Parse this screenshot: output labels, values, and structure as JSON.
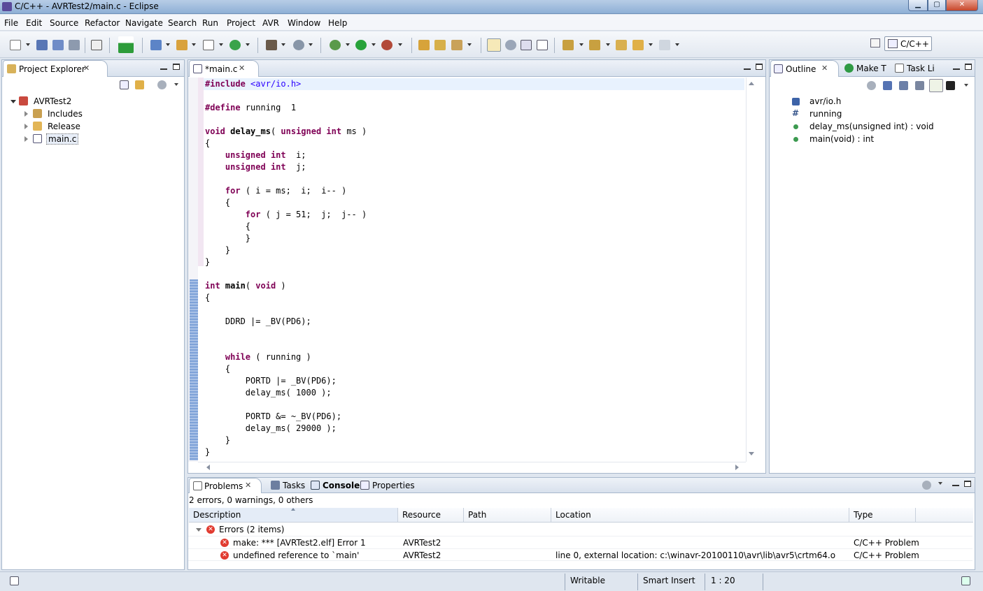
{
  "window": {
    "title": "C/C++ - AVRTest2/main.c - Eclipse",
    "min": "▁",
    "max": "▢",
    "close": "✕"
  },
  "menu": [
    "File",
    "Edit",
    "Source",
    "Refactor",
    "Navigate",
    "Search",
    "Run",
    "Project",
    "AVR",
    "Window",
    "Help"
  ],
  "toolbar": {
    "avr_label": "AVR",
    "perspective": "C/C++"
  },
  "project_explorer": {
    "title": "Project Explorer",
    "project": "AVRTest2",
    "items": [
      "Includes",
      "Release",
      "main.c"
    ]
  },
  "editor": {
    "tab": "*main.c",
    "lines": [
      {
        "t": "include"
      },
      {
        "t": "blank"
      },
      {
        "t": "define"
      },
      {
        "t": "blank"
      },
      {
        "t": "delayfn"
      },
      {
        "t": "plain",
        "v": "{"
      },
      {
        "t": "decl",
        "v": "j"
      },
      {
        "t": "decl2"
      },
      {
        "t": "blank"
      },
      {
        "t": "for1"
      },
      {
        "t": "plain",
        "v": "    {"
      },
      {
        "t": "for2"
      },
      {
        "t": "plain",
        "v": "        {"
      },
      {
        "t": "plain",
        "v": "        }"
      },
      {
        "t": "plain",
        "v": "    }"
      },
      {
        "t": "plain",
        "v": "}"
      }
    ],
    "code": {
      "include_kw": "#include",
      "include_file": "<avr/io.h>",
      "define_kw": "#define",
      "define_rest": " running  1",
      "void": "void",
      "delay_name": "delay_ms",
      "delay_open": "( ",
      "unsigned": "unsigned",
      "int": "int",
      "delay_close": " ms )",
      "decl_i": "  i;",
      "decl_j": "  j;",
      "for": "for",
      "for1_rest": " ( i = ms;  i;  i-- )",
      "for2_rest": " ( j = 51;  j;  j-- )",
      "main_int": "int",
      "main_name": "main",
      "main_open": "( ",
      "main_void": "void",
      "main_close": " )",
      "ddrd": "DDRD |= _BV(PD6);",
      "while": "while",
      "while_rest": " ( running )",
      "portd1": "PORTD |= _BV(PD6);",
      "delay1": "delay_ms( 1000 );",
      "portd2": "PORTD &= ~_BV(PD6);",
      "delay2": "delay_ms( 29000 );",
      "open_brace": "{",
      "close_brace": "}"
    }
  },
  "outline": {
    "tabs": [
      "Outline",
      "Make T",
      "Task Li"
    ],
    "items": [
      {
        "label": "avr/io.h",
        "icon": "include-icon"
      },
      {
        "label": "running",
        "icon": "macro-icon"
      },
      {
        "label": "delay_ms(unsigned int) : void",
        "icon": "function-icon"
      },
      {
        "label": "main(void) : int",
        "icon": "function-icon"
      }
    ]
  },
  "problems": {
    "tabs": [
      "Problems",
      "Tasks",
      "Console",
      "Properties"
    ],
    "summary": "2 errors, 0 warnings, 0 others",
    "columns": [
      "Description",
      "Resource",
      "Path",
      "Location",
      "Type"
    ],
    "group": "Errors (2 items)",
    "rows": [
      {
        "description": "make: *** [AVRTest2.elf] Error 1",
        "resource": "AVRTest2",
        "path": "",
        "location": "",
        "type": "C/C++ Problem"
      },
      {
        "description": "undefined reference to `main'",
        "resource": "AVRTest2",
        "path": "",
        "location": "line 0, external location: c:\\winavr-20100110\\avr\\lib\\avr5\\crtm64.o",
        "type": "C/C++ Problem"
      }
    ]
  },
  "status": {
    "writable": "Writable",
    "insert": "Smart Insert",
    "position": "1 : 20"
  },
  "colors": {
    "keyword": "#7f0055",
    "include": "#2a00ff",
    "error": "#e13b30"
  }
}
